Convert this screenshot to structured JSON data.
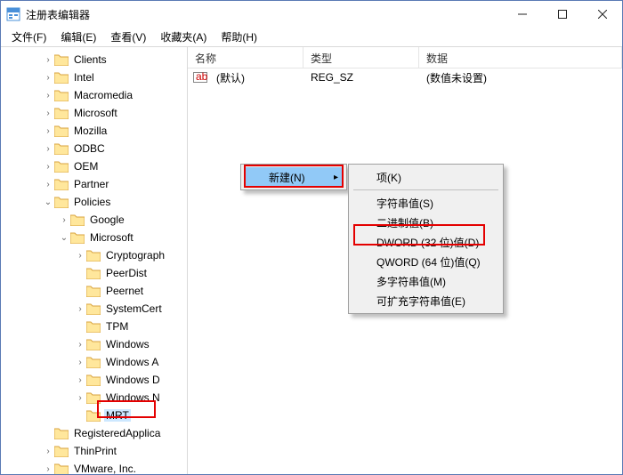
{
  "title": "注册表编辑器",
  "menubar": [
    "文件(F)",
    "编辑(E)",
    "查看(V)",
    "收藏夹(A)",
    "帮助(H)"
  ],
  "columns": {
    "name": "名称",
    "type": "类型",
    "data": "数据"
  },
  "row": {
    "name": "(默认)",
    "type": "REG_SZ",
    "data": "(数值未设置)"
  },
  "tree": {
    "clients": "Clients",
    "intel": "Intel",
    "macromedia": "Macromedia",
    "microsoft": "Microsoft",
    "mozilla": "Mozilla",
    "odbc": "ODBC",
    "oem": "OEM",
    "partner": "Partner",
    "policies": "Policies",
    "google": "Google",
    "ms": "Microsoft",
    "crypto": "Cryptograph",
    "peerdist": "PeerDist",
    "peernet": "Peernet",
    "systemcert": "SystemCert",
    "tpm": "TPM",
    "windows": "Windows",
    "windowsa": "Windows A",
    "windowsd": "Windows D",
    "windowsn": "Windows N",
    "mrt": "MRT",
    "regapp": "RegisteredApplica",
    "thinprint": "ThinPrint",
    "vmware": "VMware, Inc."
  },
  "ctx1": {
    "new": "新建(N)"
  },
  "ctx2": {
    "key": "项(K)",
    "string": "字符串值(S)",
    "binary": "二进制值(B)",
    "dword": "DWORD (32 位)值(D)",
    "qword": "QWORD (64 位)值(Q)",
    "multi": "多字符串值(M)",
    "expand": "可扩充字符串值(E)"
  }
}
